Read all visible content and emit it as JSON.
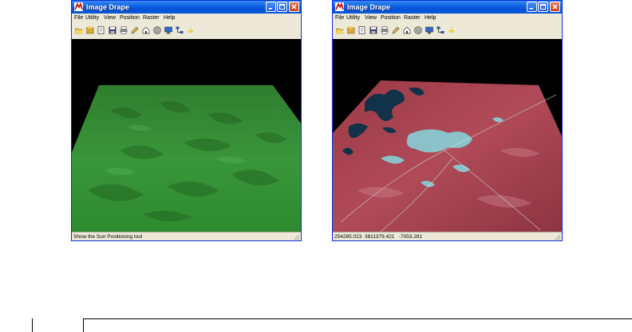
{
  "windows": [
    {
      "title": "Image Drape",
      "menu": [
        "File",
        "Utility",
        "View",
        "Position",
        "Raster",
        "Help"
      ],
      "toolbar_icons": [
        "open-folder-icon",
        "open-file-icon",
        "document-icon",
        "save-icon",
        "print-icon",
        "pencil-icon",
        "house-icon",
        "target-icon",
        "monitor-icon",
        "tree-icon",
        "sun-icon"
      ],
      "status": "Show the Sun Positioning tool",
      "view": "green-terrain"
    },
    {
      "title": "Image Drape",
      "menu": [
        "File",
        "Utility",
        "View",
        "Position",
        "Raster",
        "Help"
      ],
      "toolbar_icons": [
        "open-folder-icon",
        "open-file-icon",
        "document-icon",
        "save-icon",
        "print-icon",
        "pencil-icon",
        "house-icon",
        "target-icon",
        "monitor-icon",
        "tree-icon",
        "sun-icon"
      ],
      "status": "254285.023  3811379.421   -7053.281",
      "view": "false-color-draped-image"
    }
  ],
  "colors": {
    "titlebar": "#0a5fe0",
    "window_bg": "#ece9d8",
    "terrain_green": "#2f8a2f",
    "drape_red": "#a2404e",
    "water": "#12324a",
    "urban_cyan": "#86d8df"
  }
}
